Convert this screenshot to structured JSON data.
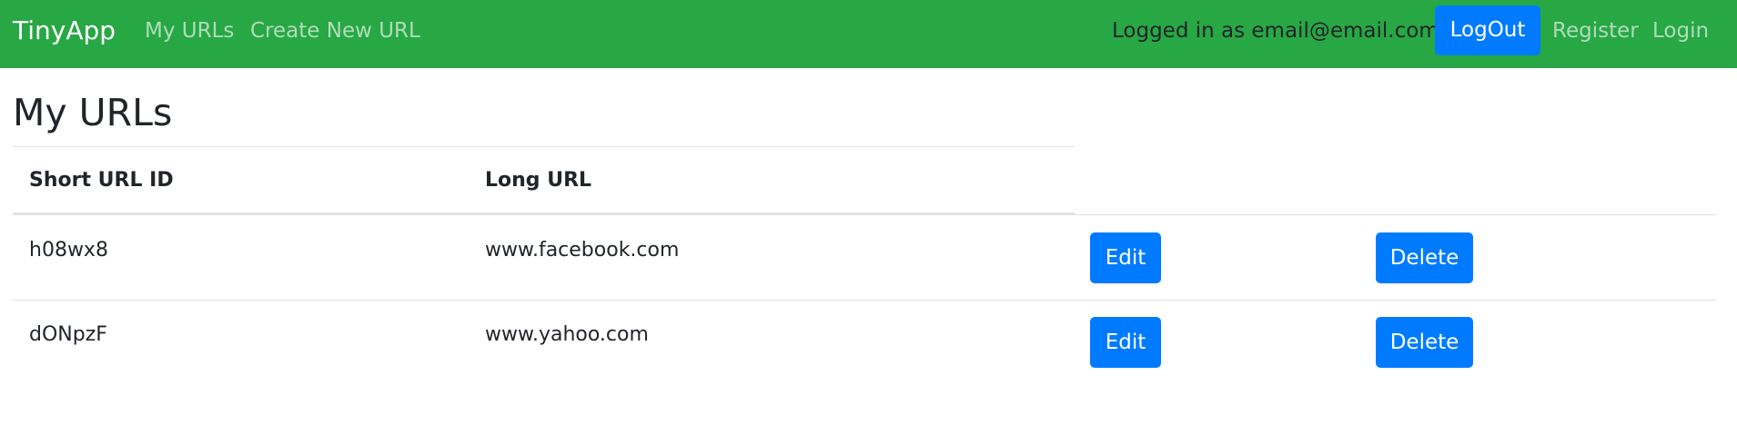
{
  "navbar": {
    "brand": "TinyApp",
    "links": {
      "my_urls": "My URLs",
      "create_new_url": "Create New URL",
      "register": "Register",
      "login": "Login"
    },
    "logged_in_text": "Logged in as email@email.com",
    "logout_label": "LogOut"
  },
  "page": {
    "title": "My URLs"
  },
  "table": {
    "headers": {
      "short_url_id": "Short URL ID",
      "long_url": "Long URL"
    },
    "rows": [
      {
        "short_id": "h08wx8",
        "long_url": "www.facebook.com",
        "edit_label": "Edit",
        "delete_label": "Delete"
      },
      {
        "short_id": "dONpzF",
        "long_url": "www.yahoo.com",
        "edit_label": "Edit",
        "delete_label": "Delete"
      }
    ]
  },
  "colors": {
    "navbar_bg": "#28a745",
    "primary_button": "#007bff",
    "text": "#212529",
    "nav_link_muted": "rgba(255,255,255,0.62)",
    "border": "#dee2e6"
  }
}
